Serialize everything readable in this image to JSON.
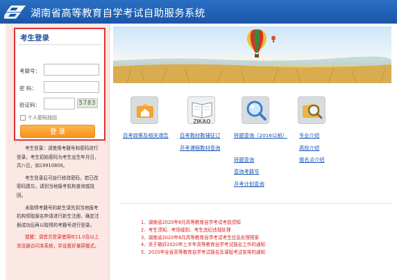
{
  "header": {
    "title": "湖南省高等教育自学考试自助服务系统"
  },
  "login": {
    "title": "考生登录",
    "exam_no_label": "考籍号：",
    "exam_no_value": "",
    "password_label": "密  码：",
    "password_value": "",
    "captcha_label": "验证码：",
    "captcha_value": "",
    "captcha_text": "5783",
    "remember_label": "个人密码找回",
    "submit_label": "登 录"
  },
  "tips": {
    "p1": "考生登录：请使用考籍号和密码进行登录，考生初始密码为考生出生年月日，共八位，如19910809。",
    "p2": "考生登录后可自行修改密码，若已改密码遗忘，请到当地报考机构查询或找回。",
    "p3": "未取得考籍号的新生请先到当地报考机构领取报名申请进行新生注册，确定注册成功后再以取得的考籍号进行登录。",
    "warn": "提醒：请首次登录使用IE11.0及以上浏览器访问本系统，并设置好兼容模式。"
  },
  "icons": {
    "col1": {
      "icon": "house-folder-icon",
      "link1": "自考政策及相关通告"
    },
    "col2": {
      "icon": "zikao-book-icon",
      "icon_text": "ZIKAO",
      "link1": "自考教材教辅征订",
      "link2": "开考课程教材查询"
    },
    "col3": {
      "icon": "magnifier-icon",
      "link1": "转题查询（2016以前）",
      "link2": "转题查询",
      "link3": "查询考籍号",
      "link4": "开考计划查询"
    },
    "col4": {
      "icon": "search-folder-icon",
      "link1": "专业介绍",
      "link2": "高校介绍",
      "link3": "报名点介绍"
    }
  },
  "news": [
    "1、湖南省2020年8月高等教育自学考试考前须知",
    "2、考生须知、考场规则、考生违纪违规处理",
    "3、湖南省2020年8月高等教育自学考试考生应急处理预案",
    "4、关于做好2020年上半年高等教育自学考试报名工作的通知",
    "5、2020年全省高等教育自学考试报名及课程考试安排的通知"
  ],
  "colors": {
    "header": "#1a56a8",
    "accent": "#f7931e",
    "highlight": "#e03030",
    "link": "#1c58b8"
  }
}
